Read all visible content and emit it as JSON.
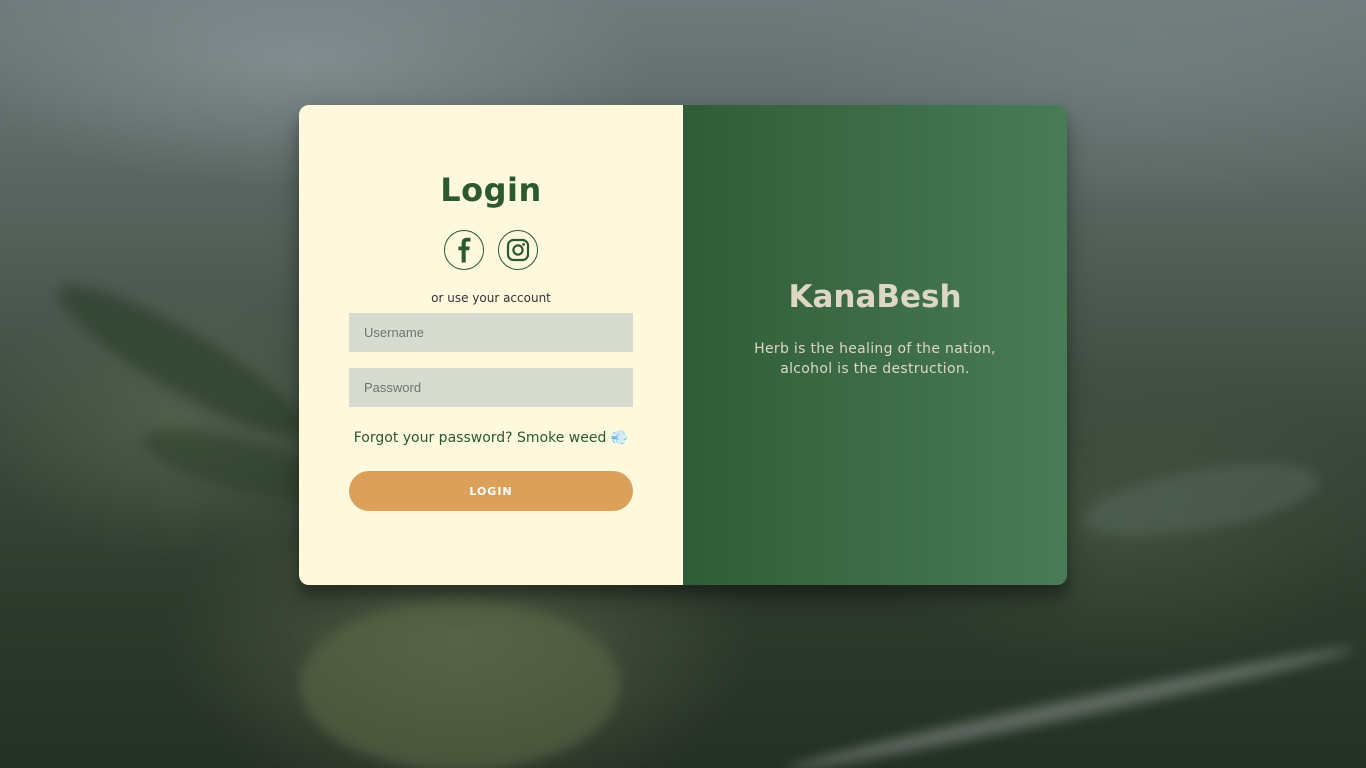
{
  "login": {
    "title": "Login",
    "or_text": "or use your account",
    "username_placeholder": "Username",
    "password_placeholder": "Password",
    "forgot_text": "Forgot your password? Smoke weed 💨",
    "login_button": "LOGIN",
    "socials": [
      "facebook-icon",
      "instagram-icon"
    ]
  },
  "overlay": {
    "brand": "KanaBesh",
    "tagline": "Herb is the healing of the nation, alcohol is the destruction."
  },
  "colors": {
    "left_panel": "#fef8dd",
    "right_panel": "#3f6e4a",
    "accent": "#dba15b",
    "text_green": "#2b5a2f",
    "input_bg": "#d8dbd0"
  }
}
